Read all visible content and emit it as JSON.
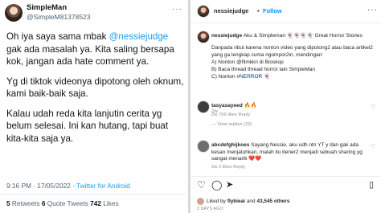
{
  "tweet": {
    "name": "SimpleMan",
    "handle": "@SimpleM81378523",
    "more": "···",
    "p1_pre": "Oh iya saya sama mbak ",
    "p1_mention": "@nessiejudge",
    "p1_post": " gak ada masalah ya. Kita saling bersapa kok, jangan ada hate comment ya.",
    "p2": "Yg di tiktok videonya dipotong oleh oknum, kami baik-baik saja.",
    "p3": "Kalau udah reda kita lanjutin cerita yg belum selesai. Ini kan hutang, tapi buat kita-kita saja ya.",
    "time": "9:16 PM · 17/05/2022 · ",
    "source": "Twitter for Android",
    "retweets_count": "5",
    "retweets_label": " Retweets ",
    "quotes_count": "6",
    "quotes_label": " Quote Tweets ",
    "likes_count": "742",
    "likes_label": " Likes"
  },
  "instagram": {
    "username": "nessiejudge",
    "separator": "•",
    "follow_label": "Follow",
    "more": "···",
    "caption_user": "nessiejudge",
    "caption_title": "Aku & Simpleman 👻👻👻👻 Great Horror Stories",
    "caption_p1": "Danpada ribut karena nonton video yang dipotong2 atau baca artikel2 yang ga lengkap cuma ngompor2in, mendingan:",
    "caption_a": "A) Nonton @filmkkn di Bioskop",
    "caption_b": "B) Baca thread thread horror lain SimpleMan",
    "caption_c_pre": "C) Nonton ",
    "caption_c_tag": "#NERROR",
    "caption_c_post": " 👻",
    "caption_time": "2w",
    "comment1_user": "tasyasayeed",
    "comment1_text": "🔥🔥",
    "comment1_meta": "2w   756 likes   Reply",
    "comment1_replies": "—  View replies (29)",
    "comment2_user": "abcdefghijkoes",
    "comment2_text": "Sayang Nessie, aku udh ntn YT y dan gak ada kesan menjatuhkan, malah itu bener2 menjadi sebuah sharing yg sangat menarik ❤️❤️",
    "comment2_meta": "2w   2 likes   Reply",
    "liked_pre": "Liked by ",
    "liked_user": "flybieai",
    "liked_mid": " and ",
    "liked_count": "43,545 others",
    "date": "2 DAYS AGO",
    "icons": [
      "heart-icon",
      "comment-icon",
      "share-icon",
      "bookmark-icon"
    ]
  }
}
